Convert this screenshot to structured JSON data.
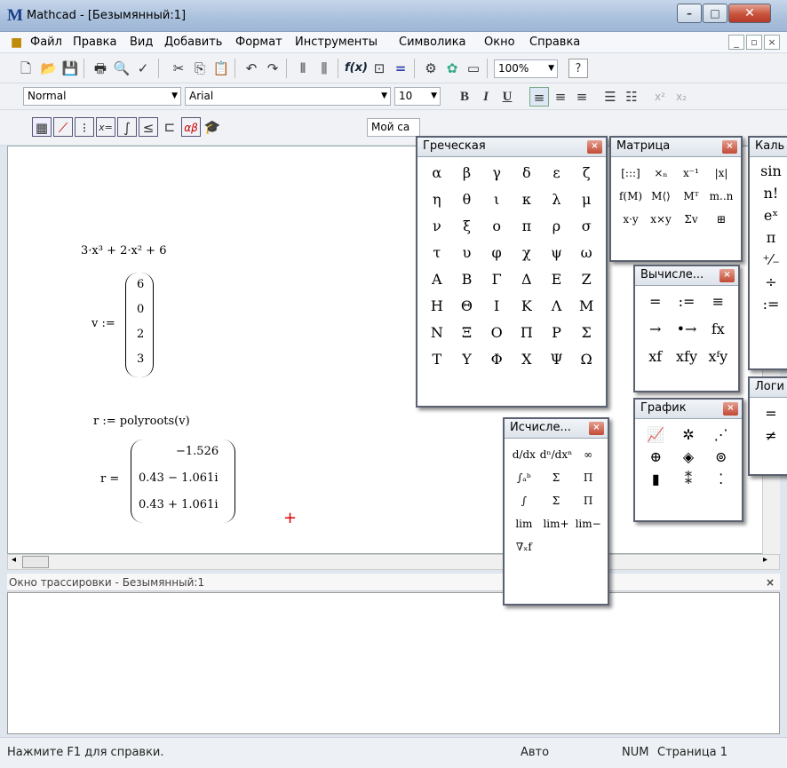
{
  "window": {
    "title": "Mathcad - [Безымянный:1]",
    "app_icon": "M",
    "controls": [
      "–",
      "□",
      "✕"
    ]
  },
  "menu": {
    "items": [
      "Файл",
      "Правка",
      "Вид",
      "Добавить",
      "Формат",
      "Инструменты",
      "Символика",
      "Окно",
      "Справка"
    ]
  },
  "toolbar": {
    "zoom": "100%",
    "style": "Normal",
    "font": "Arial",
    "size": "10",
    "bold": "B",
    "italic": "I",
    "underline": "U",
    "resource_combo": "Мой са"
  },
  "worksheet": {
    "poly": "3·x³ + 2·x² + 6",
    "v_label": "v :=",
    "v_values": [
      "6",
      "0",
      "2",
      "3"
    ],
    "r_def": "r := polyroots(v)",
    "r_label": "r =",
    "r_values": [
      "−1.526",
      "0.43 − 1.061i",
      "0.43 + 1.061i"
    ]
  },
  "trace": {
    "title": "Окно трассировки - Безымянный:1"
  },
  "status": {
    "help": "Нажмите F1 для справки.",
    "mode": "Авто",
    "num": "NUM",
    "page": "Страница 1"
  },
  "palettes": {
    "greek": {
      "title": "Греческая",
      "symbols": [
        "α",
        "β",
        "γ",
        "δ",
        "ε",
        "ζ",
        "η",
        "θ",
        "ι",
        "κ",
        "λ",
        "μ",
        "ν",
        "ξ",
        "ο",
        "π",
        "ρ",
        "σ",
        "τ",
        "υ",
        "φ",
        "χ",
        "ψ",
        "ω",
        "Α",
        "Β",
        "Γ",
        "Δ",
        "Ε",
        "Ζ",
        "Η",
        "Θ",
        "Ι",
        "Κ",
        "Λ",
        "Μ",
        "Ν",
        "Ξ",
        "Ο",
        "Π",
        "Ρ",
        "Σ",
        "Τ",
        "Υ",
        "Φ",
        "Χ",
        "Ψ",
        "Ω"
      ]
    },
    "matrix": {
      "title": "Матрица",
      "symbols": [
        "[:::]",
        "×ₙ",
        "x⁻¹",
        "|x|",
        "f(M)",
        "M⟨⟩",
        "Mᵀ",
        "m..n",
        "x·y",
        "x×y",
        "Σv",
        "⊞"
      ]
    },
    "eval": {
      "title": "Вычисле...",
      "symbols": [
        "=",
        ":=",
        "≡",
        "→",
        "•→",
        "fx",
        "xf",
        "xfy",
        "xᶠy"
      ]
    },
    "graph": {
      "title": "График",
      "symbols": [
        "📈",
        "✲",
        "⋰",
        "⊕",
        "◈",
        "⊚",
        "▮",
        "⁑",
        "⁚"
      ]
    },
    "calc": {
      "title": "Исчисле...",
      "symbols": [
        "d/dx",
        "dⁿ/dxⁿ",
        "∞",
        "∫ₐᵇ",
        "Σ",
        "Π",
        "∫",
        "Σ",
        "Π",
        "lim",
        "lim+",
        "lim−",
        "∇ₓf"
      ]
    },
    "calc2": {
      "title": "Каль",
      "symbols": [
        "sin",
        "n!",
        "eˣ",
        "π",
        "⁺⁄₋",
        "÷",
        ":="
      ]
    },
    "logic": {
      "title": "Логи",
      "symbols": [
        "=",
        "≠"
      ]
    }
  }
}
